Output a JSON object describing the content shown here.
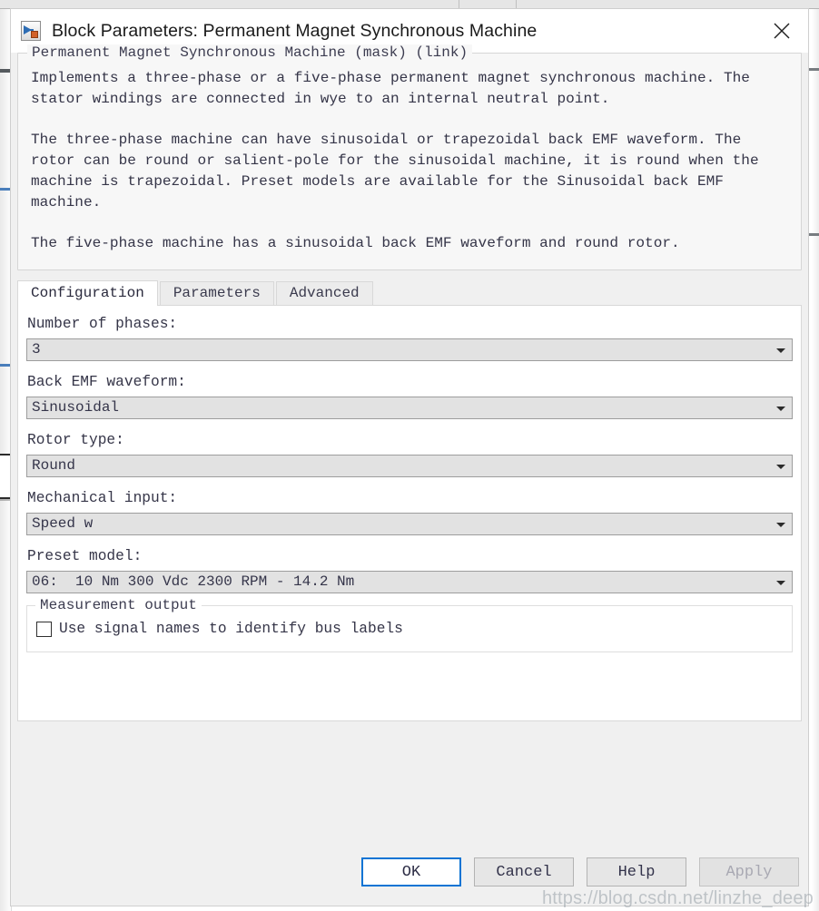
{
  "window": {
    "title": "Block Parameters: Permanent Magnet Synchronous Machine",
    "icon": "simulink-block-icon",
    "close_icon": "close-icon"
  },
  "description": {
    "group_title": "Permanent Magnet Synchronous Machine (mask) (link)",
    "paragraphs": [
      "Implements a three-phase or a five-phase permanent magnet synchronous machine. The\nstator windings are connected in wye to an internal neutral point.",
      "The three-phase machine can have sinusoidal or trapezoidal back EMF waveform. The\nrotor can be round or salient-pole for the sinusoidal machine, it is round when the\nmachine is trapezoidal. Preset models are available for the Sinusoidal back EMF\nmachine.",
      "The five-phase machine has a sinusoidal back EMF waveform and round rotor."
    ]
  },
  "tabs": [
    {
      "label": "Configuration",
      "active": true
    },
    {
      "label": "Parameters",
      "active": false
    },
    {
      "label": "Advanced",
      "active": false
    }
  ],
  "fields": [
    {
      "label": "Number of phases:",
      "value": "3",
      "name": "number-of-phases"
    },
    {
      "label": "Back EMF waveform:",
      "value": "Sinusoidal",
      "name": "back-emf-waveform"
    },
    {
      "label": "Rotor type:",
      "value": "Round",
      "name": "rotor-type"
    },
    {
      "label": "Mechanical input:",
      "value": "Speed w",
      "name": "mechanical-input"
    },
    {
      "label": "Preset model:",
      "value": "06:  10 Nm 300 Vdc 2300 RPM - 14.2 Nm",
      "name": "preset-model"
    }
  ],
  "measurement_group": {
    "legend": "Measurement output",
    "checkbox_label": "Use signal names to identify bus labels",
    "checked": false
  },
  "footer": {
    "buttons": [
      {
        "label": "OK",
        "style": "primary",
        "name": "ok-button"
      },
      {
        "label": "Cancel",
        "style": "normal",
        "name": "cancel-button"
      },
      {
        "label": "Help",
        "style": "normal",
        "name": "help-button"
      },
      {
        "label": "Apply",
        "style": "disabled",
        "name": "apply-button"
      }
    ]
  },
  "watermark": "https://blog.csdn.net/linzhe_deep",
  "colors": {
    "accent": "#0a74d4",
    "dialog_bg": "#f0f0f0",
    "field_bg": "#e2e2e2",
    "text": "#353548"
  }
}
